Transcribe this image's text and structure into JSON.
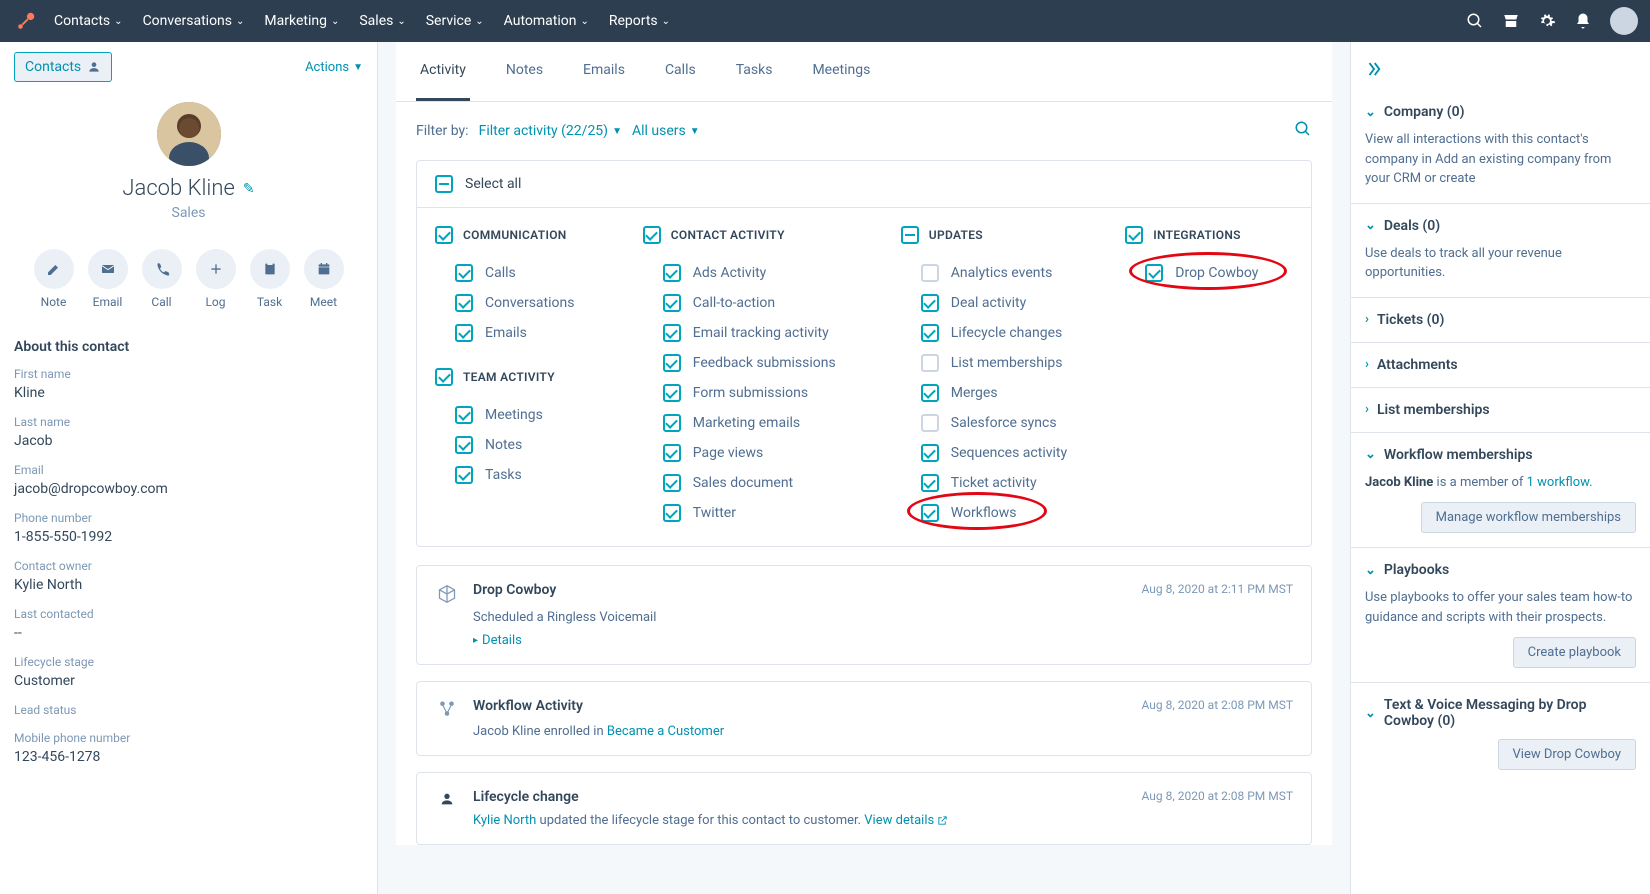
{
  "nav": {
    "items": [
      "Contacts",
      "Conversations",
      "Marketing",
      "Sales",
      "Service",
      "Automation",
      "Reports"
    ]
  },
  "leftPanel": {
    "contactsLabel": "Contacts",
    "actionsLabel": "Actions",
    "contactName": "Jacob Kline",
    "contactSubtitle": "Sales",
    "actionIcons": [
      {
        "label": "Note",
        "icon": "note"
      },
      {
        "label": "Email",
        "icon": "email"
      },
      {
        "label": "Call",
        "icon": "call"
      },
      {
        "label": "Log",
        "icon": "log"
      },
      {
        "label": "Task",
        "icon": "task"
      },
      {
        "label": "Meet",
        "icon": "meet"
      }
    ],
    "aboutHeader": "About this contact",
    "fields": [
      {
        "label": "First name",
        "value": "Kline"
      },
      {
        "label": "Last name",
        "value": "Jacob"
      },
      {
        "label": "Email",
        "value": "jacob@dropcowboy.com"
      },
      {
        "label": "Phone number",
        "value": "1-855-550-1992"
      },
      {
        "label": "Contact owner",
        "value": "Kylie North"
      },
      {
        "label": "Last contacted",
        "value": "--"
      },
      {
        "label": "Lifecycle stage",
        "value": "Customer"
      },
      {
        "label": "Lead status",
        "value": ""
      },
      {
        "label": "Mobile phone number",
        "value": "123-456-1278"
      }
    ]
  },
  "center": {
    "tabs": [
      "Activity",
      "Notes",
      "Emails",
      "Calls",
      "Tasks",
      "Meetings"
    ],
    "activeTab": 0,
    "filterByLabel": "Filter by:",
    "filterActivity": "Filter activity (22/25)",
    "allUsers": "All users",
    "selectAll": "Select all",
    "columns": {
      "communication": {
        "header": "COMMUNICATION",
        "checked": true,
        "items": [
          {
            "label": "Calls",
            "checked": true
          },
          {
            "label": "Conversations",
            "checked": true
          },
          {
            "label": "Emails",
            "checked": true
          }
        ]
      },
      "teamActivity": {
        "header": "TEAM ACTIVITY",
        "checked": true,
        "items": [
          {
            "label": "Meetings",
            "checked": true
          },
          {
            "label": "Notes",
            "checked": true
          },
          {
            "label": "Tasks",
            "checked": true
          }
        ]
      },
      "contactActivity": {
        "header": "CONTACT ACTIVITY",
        "checked": true,
        "items": [
          {
            "label": "Ads Activity",
            "checked": true
          },
          {
            "label": "Call-to-action",
            "checked": true
          },
          {
            "label": "Email tracking activity",
            "checked": true
          },
          {
            "label": "Feedback submissions",
            "checked": true
          },
          {
            "label": "Form submissions",
            "checked": true
          },
          {
            "label": "Marketing emails",
            "checked": true
          },
          {
            "label": "Page views",
            "checked": true
          },
          {
            "label": "Sales document",
            "checked": true
          },
          {
            "label": "Twitter",
            "checked": true
          }
        ]
      },
      "updates": {
        "header": "UPDATES",
        "indeterminate": true,
        "items": [
          {
            "label": "Analytics events",
            "checked": false
          },
          {
            "label": "Deal activity",
            "checked": true
          },
          {
            "label": "Lifecycle changes",
            "checked": true
          },
          {
            "label": "List memberships",
            "checked": false
          },
          {
            "label": "Merges",
            "checked": true
          },
          {
            "label": "Salesforce syncs",
            "checked": false
          },
          {
            "label": "Sequences activity",
            "checked": true
          },
          {
            "label": "Ticket activity",
            "checked": true
          },
          {
            "label": "Workflows",
            "checked": true
          }
        ]
      },
      "integrations": {
        "header": "INTEGRATIONS",
        "checked": true,
        "items": [
          {
            "label": "Drop Cowboy",
            "checked": true
          }
        ]
      }
    },
    "activities": [
      {
        "icon": "cube",
        "title": "Drop Cowboy",
        "time": "Aug 8, 2020 at 2:11 PM MST",
        "body": "Scheduled a Ringless Voicemail",
        "detailsLabel": "Details"
      },
      {
        "icon": "workflow",
        "title": "Workflow Activity",
        "time": "Aug 8, 2020 at 2:08 PM MST",
        "bodyParts": {
          "pre": "Jacob Kline  enrolled in ",
          "link": "Became a Customer"
        }
      },
      {
        "icon": "person",
        "title": "Lifecycle change",
        "time": "Aug 8, 2020 at 2:08 PM MST",
        "bodyParts": {
          "linkPre": "Kylie North",
          "mid": " updated the lifecycle stage for this contact to customer. ",
          "link2": "View details"
        }
      }
    ]
  },
  "rightPanel": {
    "sections": [
      {
        "title": "Company (0)",
        "open": true,
        "body": "View all interactions with this contact's company in Add an existing company from your CRM or create"
      },
      {
        "title": "Deals (0)",
        "open": true,
        "body": "Use deals to track all your revenue opportunities."
      },
      {
        "title": "Tickets (0)",
        "open": false
      },
      {
        "title": "Attachments",
        "open": false
      },
      {
        "title": "List memberships",
        "open": false
      },
      {
        "title": "Workflow memberships",
        "open": true,
        "bodyParts": {
          "name": "Jacob Kline",
          "mid": " is a member of ",
          "link": "1 workflow."
        },
        "button": "Manage workflow memberships"
      },
      {
        "title": "Playbooks",
        "open": true,
        "body": "Use playbooks to offer your sales team how-to guidance and scripts with their prospects.",
        "button": "Create playbook"
      },
      {
        "title": "Text & Voice Messaging by Drop Cowboy (0)",
        "open": true,
        "button": "View Drop Cowboy"
      }
    ]
  }
}
